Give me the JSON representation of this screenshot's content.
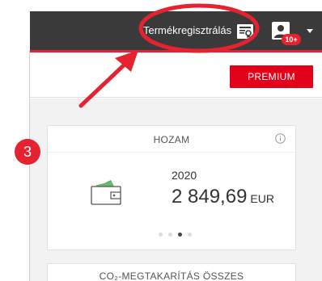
{
  "header": {
    "product_registration_label": "Termékregisztrálás",
    "notification_badge": "10+"
  },
  "premium_button_label": "PREMIUM",
  "step_number": "3",
  "yield_card": {
    "title": "HOZAM",
    "year": "2020",
    "amount": "2 849,69",
    "currency": "EUR",
    "pagination": {
      "count": 4,
      "active_index": 2
    }
  },
  "co2_card": {
    "title": "CO₂-MEGTAKARÍTÁS ÖSSZES"
  },
  "colors": {
    "topbar": "#3a3a3a",
    "accent_red": "#e52330",
    "premium_red": "#e2001a"
  },
  "icons": {
    "registration": "certificate-icon",
    "user": "user-icon",
    "menu": "chevron-down-icon",
    "info": "info-icon",
    "wallet": "wallet-icon"
  }
}
